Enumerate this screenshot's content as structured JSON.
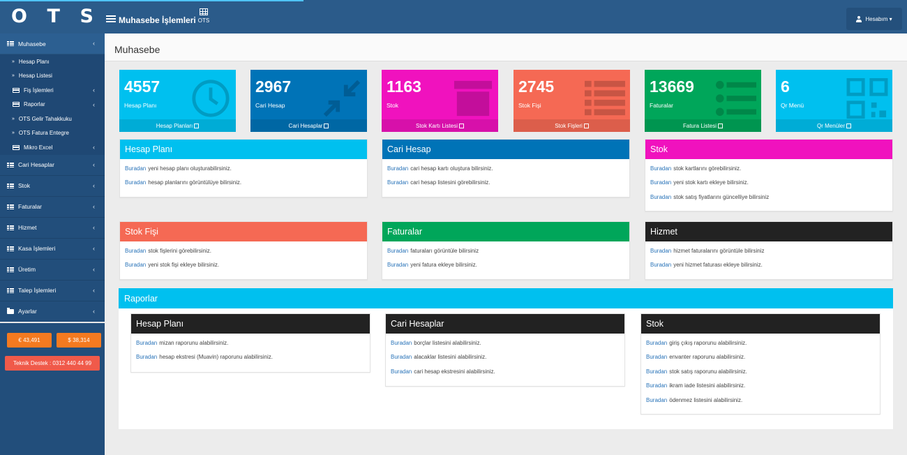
{
  "topbar": {
    "logo_letters": [
      "O",
      "T",
      "S"
    ],
    "title": "Muhasebe İşlemleri",
    "ots_label": "OTS",
    "account_label": "Hesabım ▾"
  },
  "sidebar": {
    "active": {
      "label": "Muhasebe",
      "chevron": "‹"
    },
    "sub_items": [
      {
        "label": "Hesap Planı",
        "icon": "angle-double-right-icon",
        "chevron": ""
      },
      {
        "label": "Hesap Listesi",
        "icon": "angle-double-right-icon",
        "chevron": ""
      },
      {
        "label": "Fiş İşlemleri",
        "icon": "credit-card-icon",
        "chevron": "‹"
      },
      {
        "label": "Raporlar",
        "icon": "credit-card-icon",
        "chevron": "‹"
      },
      {
        "label": "OTS Gelir Tahakkuku",
        "icon": "angle-double-right-icon",
        "chevron": ""
      },
      {
        "label": "OTS Fatura Entegre",
        "icon": "angle-double-right-icon",
        "chevron": ""
      },
      {
        "label": "Mikro Excel",
        "icon": "credit-card-icon",
        "chevron": "‹"
      }
    ],
    "items": [
      {
        "label": "Cari Hesaplar",
        "icon": "list-icon"
      },
      {
        "label": "Stok",
        "icon": "list-icon"
      },
      {
        "label": "Faturalar",
        "icon": "list-icon"
      },
      {
        "label": "Hizmet",
        "icon": "list-icon"
      },
      {
        "label": "Kasa İşlemleri",
        "icon": "list-icon"
      },
      {
        "label": "Üretim",
        "icon": "list-icon"
      },
      {
        "label": "Talep İşlemleri",
        "icon": "list-icon"
      },
      {
        "label": "Ayarlar",
        "icon": "folder-icon"
      }
    ],
    "chevron": "‹",
    "currency_eur": "€ 43,491",
    "currency_usd": "$ 38,314",
    "support": "Teknik Destek : 0312 440 44 99",
    "colors": {
      "bg": "#224e7b",
      "currency": "#f47a20",
      "support": "#f05a4a"
    }
  },
  "page_title": "Muhasebe",
  "tiles": [
    {
      "num": "4557",
      "label": "Hesap Planı",
      "link": "Hesap Planları",
      "color": "#00c0ef",
      "icon": "clock-icon"
    },
    {
      "num": "2967",
      "label": "Cari Hesap",
      "link": "Cari Hesaplar",
      "color": "#0073b7",
      "icon": "compress-icon"
    },
    {
      "num": "1163",
      "label": "Stok",
      "link": "Stok Kartı Listesi",
      "color": "#f012be",
      "icon": "archive-icon"
    },
    {
      "num": "2745",
      "label": "Stok Fişi",
      "link": "Stok Fişleri",
      "color": "#f56954",
      "icon": "list-icon"
    },
    {
      "num": "13669",
      "label": "Faturalar",
      "link": "Fatura Listesi",
      "color": "#00a65a",
      "icon": "list-ul-icon"
    },
    {
      "num": "6",
      "label": "Qr Menü",
      "link": "Qr Menüler",
      "color": "#00c0ef",
      "icon": "qrcode-icon"
    }
  ],
  "link_word": "Buradan",
  "panels": [
    {
      "title": "Hesap Planı",
      "color": "#00c0ef",
      "rows": [
        "yeni hesap planı oluşturabilirsiniz.",
        "hesap planlarını görüntülüye bilirsiniz."
      ]
    },
    {
      "title": "Cari Hesap",
      "color": "#0073b7",
      "rows": [
        "cari hesap kartı oluştura bilirsiniz.",
        "cari hesap listesini görebilirsiniz."
      ]
    },
    {
      "title": "Stok",
      "color": "#f012be",
      "rows": [
        "stok kartlarını görebilirsiniz.",
        "yeni stok kartı ekleye bilirsiniz.",
        "stok satış fiyatlarını güncelliye bilirsiniz"
      ]
    },
    {
      "title": "Stok Fişi",
      "color": "#f56954",
      "rows": [
        "stok fişlerini görebilirsiniz.",
        "yeni stok fişi ekleye bilirsiniz."
      ]
    },
    {
      "title": "Faturalar",
      "color": "#00a65a",
      "rows": [
        "faturaları görüntüle bilirsiniz",
        "yeni fatura ekleye bilirsiniz."
      ]
    },
    {
      "title": "Hizmet",
      "color": "#222222",
      "rows": [
        "hizmet faturalarını görüntüle bilirsiniz",
        "yeni hizmet faturası ekleye bilirsiniz."
      ]
    }
  ],
  "raporlar": {
    "title": "Raporlar",
    "color": "#00c0ef",
    "panels": [
      {
        "title": "Hesap Planı",
        "rows": [
          "mizan raporunu alabilirsiniz.",
          "hesap ekstresi (Muavin) raporunu alabilirsiniz."
        ]
      },
      {
        "title": "Cari Hesaplar",
        "rows": [
          "borçlar listesini alabilirsiniz.",
          "alacaklar listesini alabilirsiniz.",
          "cari hesap ekstresini alabilirsiniz."
        ]
      },
      {
        "title": "Stok",
        "rows": [
          "giriş çıkış raporunu alabilirsiniz.",
          "envanter raporunu alabilirsiniz.",
          "stok satış raporunu alabilirsiniz.",
          "ikram iade listesini alabilirsiniz.",
          "ödenmez listesini alabilirsiniz."
        ]
      }
    ]
  }
}
